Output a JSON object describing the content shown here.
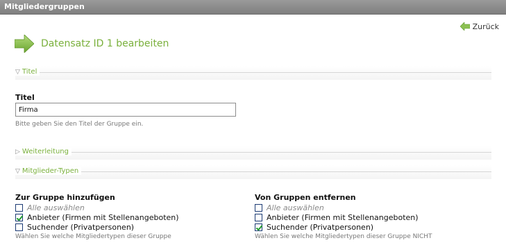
{
  "window": {
    "title": "Mitgliedergruppen"
  },
  "nav": {
    "back_label": "Zurück"
  },
  "page": {
    "heading": "Datensatz ID 1 bearbeiten"
  },
  "sections": {
    "titel": "Titel",
    "weiterleitung": "Weiterleitung",
    "mitglieder_typen": "Mitglieder-Typen"
  },
  "form": {
    "title_label": "Titel",
    "title_value": "Firma",
    "title_hint": "Bitte geben Sie den Titel der Gruppe ein."
  },
  "add_groups": {
    "heading": "Zur Gruppe hinzufügen",
    "select_all": "Alle auswählen",
    "options": [
      {
        "label": "Anbieter (Firmen mit Stellenangeboten)",
        "checked": true
      },
      {
        "label": "Suchender (Privatpersonen)",
        "checked": false
      }
    ],
    "hint": "Wählen Sie welche Mitgliedertypen dieser Gruppe"
  },
  "remove_groups": {
    "heading": "Von Gruppen entfernen",
    "select_all": "Alle auswählen",
    "options": [
      {
        "label": "Anbieter (Firmen mit Stellenangeboten)",
        "checked": false
      },
      {
        "label": "Suchender (Privatpersonen)",
        "checked": true
      }
    ],
    "hint": "Wählen Sie welche Mitgliedertypen dieser Gruppe NICHT"
  },
  "colors": {
    "accent": "#7ab03c",
    "titlebar": "#8a8a8a"
  }
}
